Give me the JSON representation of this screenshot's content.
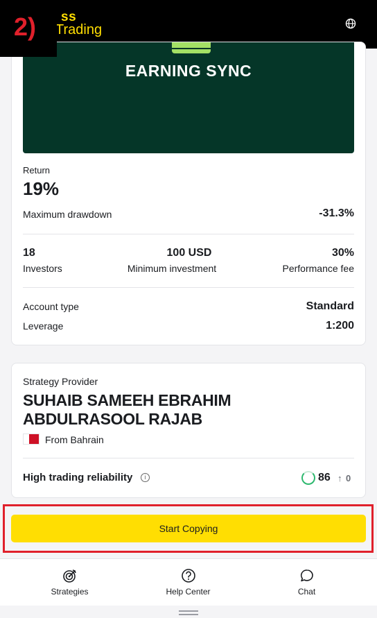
{
  "step_badge": "2)",
  "logo": {
    "line1": "ss",
    "line2": "Trading"
  },
  "cover": {
    "title": "EARNING SYNC"
  },
  "metrics": {
    "return_label": "Return",
    "return_value": "19%",
    "drawdown_label": "Maximum drawdown",
    "drawdown_value": "-31.3%"
  },
  "stats": [
    {
      "value": "18",
      "label": "Investors"
    },
    {
      "value": "100 USD",
      "label": "Minimum investment"
    },
    {
      "value": "30%",
      "label": "Performance fee"
    }
  ],
  "account": {
    "type_label": "Account type",
    "type_value": "Standard",
    "leverage_label": "Leverage",
    "leverage_value": "1:200"
  },
  "provider": {
    "label": "Strategy Provider",
    "name": "SUHAIB SAMEEH EBRAHIM ABDULRASOOL RAJAB",
    "from": "From Bahrain",
    "reliability_label": "High trading reliability",
    "score": "86",
    "delta": "0"
  },
  "cta": {
    "start_copying": "Start Copying"
  },
  "nav": [
    {
      "label": "Strategies",
      "icon": "strategies-icon"
    },
    {
      "label": "Help Center",
      "icon": "help-icon"
    },
    {
      "label": "Chat",
      "icon": "chat-icon"
    }
  ],
  "colors": {
    "brand_yellow": "#ffde02",
    "cover_green": "#053628",
    "highlight_red": "#e0202b",
    "score_green": "#2db86e"
  }
}
